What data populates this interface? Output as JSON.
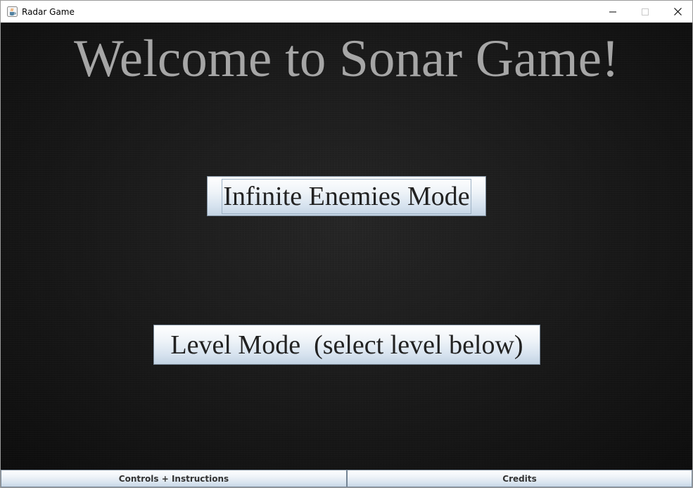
{
  "window": {
    "title": "Radar Game",
    "icon": "java-coffee-cup-icon",
    "controls": [
      "minimize-icon",
      "maximize-icon",
      "close-icon"
    ]
  },
  "main": {
    "heading": "Welcome to Sonar Game!",
    "infinite_button_label": "Infinite Enemies Mode",
    "level_button_label": "Level Mode  (select level below)"
  },
  "bottom_bar": {
    "controls_label": "Controls + Instructions",
    "credits_label": "Credits"
  },
  "colors": {
    "background": "#1b1b1b",
    "heading_text": "#a6a6a6",
    "button_gradient_top": "#ffffff",
    "button_gradient_bottom": "#c3d3e3"
  }
}
